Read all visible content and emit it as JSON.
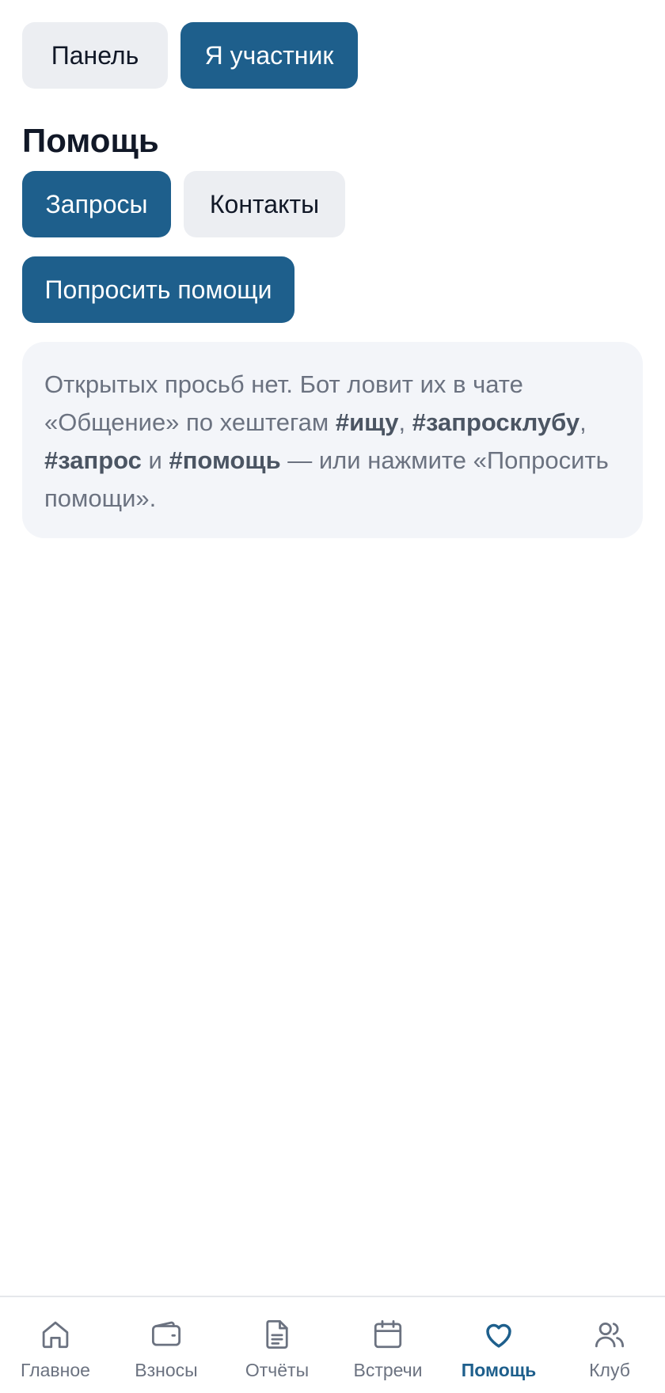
{
  "mode_switch": {
    "panel_label": "Панель",
    "member_label": "Я участник",
    "active": "member"
  },
  "page": {
    "title": "Помощь"
  },
  "tabs": {
    "requests_label": "Запросы",
    "contacts_label": "Контакты",
    "active": "requests"
  },
  "ask_button_label": "Попросить помощи",
  "empty_state": {
    "text_1": "Открытых просьб нет. Бот ловит их в чате «Общение» по хештегам ",
    "tag_1": "#ищу",
    "sep_1": ", ",
    "tag_2": "#запросклубу",
    "sep_2": ", ",
    "tag_3": "#запрос",
    "sep_3": " и ",
    "tag_4": "#помощь",
    "text_2": " — или нажмите «Попросить помощи»."
  },
  "bottom_nav": {
    "items": [
      {
        "label": "Главное",
        "icon": "home-icon"
      },
      {
        "label": "Взносы",
        "icon": "wallet-icon"
      },
      {
        "label": "Отчёты",
        "icon": "document-icon"
      },
      {
        "label": "Встречи",
        "icon": "calendar-icon"
      },
      {
        "label": "Помощь",
        "icon": "heart-icon",
        "active": true
      },
      {
        "label": "Клуб",
        "icon": "users-icon"
      }
    ]
  },
  "colors": {
    "primary": "#1e5f8c",
    "muted": "#6b7280",
    "chip_bg": "#eceef2",
    "card_bg": "#f3f5f9"
  }
}
